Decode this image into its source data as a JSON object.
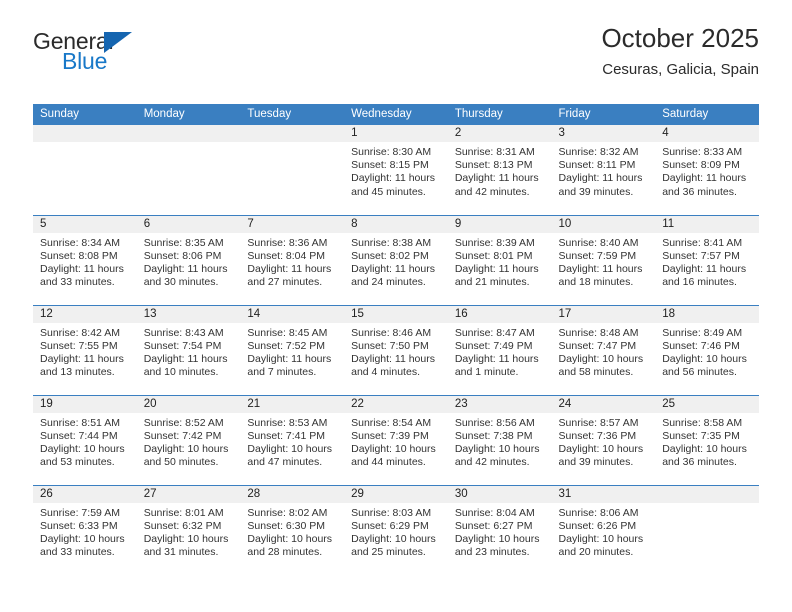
{
  "brand": {
    "name_part1": "General",
    "name_part2": "Blue",
    "accent_color": "#1878c8",
    "triangle_color": "#1565b0"
  },
  "header": {
    "title": "October 2025",
    "subtitle": "Cesuras, Galicia, Spain"
  },
  "calendar": {
    "header_bg": "#3a7fc1",
    "daynum_bg": "#f0f0f0",
    "weekday_headers": [
      "Sunday",
      "Monday",
      "Tuesday",
      "Wednesday",
      "Thursday",
      "Friday",
      "Saturday"
    ],
    "weeks": [
      [
        {
          "day": "",
          "sunrise": "",
          "sunset": "",
          "daylight_line1": "",
          "daylight_line2": ""
        },
        {
          "day": "",
          "sunrise": "",
          "sunset": "",
          "daylight_line1": "",
          "daylight_line2": ""
        },
        {
          "day": "",
          "sunrise": "",
          "sunset": "",
          "daylight_line1": "",
          "daylight_line2": ""
        },
        {
          "day": "1",
          "sunrise": "Sunrise: 8:30 AM",
          "sunset": "Sunset: 8:15 PM",
          "daylight_line1": "Daylight: 11 hours",
          "daylight_line2": "and 45 minutes."
        },
        {
          "day": "2",
          "sunrise": "Sunrise: 8:31 AM",
          "sunset": "Sunset: 8:13 PM",
          "daylight_line1": "Daylight: 11 hours",
          "daylight_line2": "and 42 minutes."
        },
        {
          "day": "3",
          "sunrise": "Sunrise: 8:32 AM",
          "sunset": "Sunset: 8:11 PM",
          "daylight_line1": "Daylight: 11 hours",
          "daylight_line2": "and 39 minutes."
        },
        {
          "day": "4",
          "sunrise": "Sunrise: 8:33 AM",
          "sunset": "Sunset: 8:09 PM",
          "daylight_line1": "Daylight: 11 hours",
          "daylight_line2": "and 36 minutes."
        }
      ],
      [
        {
          "day": "5",
          "sunrise": "Sunrise: 8:34 AM",
          "sunset": "Sunset: 8:08 PM",
          "daylight_line1": "Daylight: 11 hours",
          "daylight_line2": "and 33 minutes."
        },
        {
          "day": "6",
          "sunrise": "Sunrise: 8:35 AM",
          "sunset": "Sunset: 8:06 PM",
          "daylight_line1": "Daylight: 11 hours",
          "daylight_line2": "and 30 minutes."
        },
        {
          "day": "7",
          "sunrise": "Sunrise: 8:36 AM",
          "sunset": "Sunset: 8:04 PM",
          "daylight_line1": "Daylight: 11 hours",
          "daylight_line2": "and 27 minutes."
        },
        {
          "day": "8",
          "sunrise": "Sunrise: 8:38 AM",
          "sunset": "Sunset: 8:02 PM",
          "daylight_line1": "Daylight: 11 hours",
          "daylight_line2": "and 24 minutes."
        },
        {
          "day": "9",
          "sunrise": "Sunrise: 8:39 AM",
          "sunset": "Sunset: 8:01 PM",
          "daylight_line1": "Daylight: 11 hours",
          "daylight_line2": "and 21 minutes."
        },
        {
          "day": "10",
          "sunrise": "Sunrise: 8:40 AM",
          "sunset": "Sunset: 7:59 PM",
          "daylight_line1": "Daylight: 11 hours",
          "daylight_line2": "and 18 minutes."
        },
        {
          "day": "11",
          "sunrise": "Sunrise: 8:41 AM",
          "sunset": "Sunset: 7:57 PM",
          "daylight_line1": "Daylight: 11 hours",
          "daylight_line2": "and 16 minutes."
        }
      ],
      [
        {
          "day": "12",
          "sunrise": "Sunrise: 8:42 AM",
          "sunset": "Sunset: 7:55 PM",
          "daylight_line1": "Daylight: 11 hours",
          "daylight_line2": "and 13 minutes."
        },
        {
          "day": "13",
          "sunrise": "Sunrise: 8:43 AM",
          "sunset": "Sunset: 7:54 PM",
          "daylight_line1": "Daylight: 11 hours",
          "daylight_line2": "and 10 minutes."
        },
        {
          "day": "14",
          "sunrise": "Sunrise: 8:45 AM",
          "sunset": "Sunset: 7:52 PM",
          "daylight_line1": "Daylight: 11 hours",
          "daylight_line2": "and 7 minutes."
        },
        {
          "day": "15",
          "sunrise": "Sunrise: 8:46 AM",
          "sunset": "Sunset: 7:50 PM",
          "daylight_line1": "Daylight: 11 hours",
          "daylight_line2": "and 4 minutes."
        },
        {
          "day": "16",
          "sunrise": "Sunrise: 8:47 AM",
          "sunset": "Sunset: 7:49 PM",
          "daylight_line1": "Daylight: 11 hours",
          "daylight_line2": "and 1 minute."
        },
        {
          "day": "17",
          "sunrise": "Sunrise: 8:48 AM",
          "sunset": "Sunset: 7:47 PM",
          "daylight_line1": "Daylight: 10 hours",
          "daylight_line2": "and 58 minutes."
        },
        {
          "day": "18",
          "sunrise": "Sunrise: 8:49 AM",
          "sunset": "Sunset: 7:46 PM",
          "daylight_line1": "Daylight: 10 hours",
          "daylight_line2": "and 56 minutes."
        }
      ],
      [
        {
          "day": "19",
          "sunrise": "Sunrise: 8:51 AM",
          "sunset": "Sunset: 7:44 PM",
          "daylight_line1": "Daylight: 10 hours",
          "daylight_line2": "and 53 minutes."
        },
        {
          "day": "20",
          "sunrise": "Sunrise: 8:52 AM",
          "sunset": "Sunset: 7:42 PM",
          "daylight_line1": "Daylight: 10 hours",
          "daylight_line2": "and 50 minutes."
        },
        {
          "day": "21",
          "sunrise": "Sunrise: 8:53 AM",
          "sunset": "Sunset: 7:41 PM",
          "daylight_line1": "Daylight: 10 hours",
          "daylight_line2": "and 47 minutes."
        },
        {
          "day": "22",
          "sunrise": "Sunrise: 8:54 AM",
          "sunset": "Sunset: 7:39 PM",
          "daylight_line1": "Daylight: 10 hours",
          "daylight_line2": "and 44 minutes."
        },
        {
          "day": "23",
          "sunrise": "Sunrise: 8:56 AM",
          "sunset": "Sunset: 7:38 PM",
          "daylight_line1": "Daylight: 10 hours",
          "daylight_line2": "and 42 minutes."
        },
        {
          "day": "24",
          "sunrise": "Sunrise: 8:57 AM",
          "sunset": "Sunset: 7:36 PM",
          "daylight_line1": "Daylight: 10 hours",
          "daylight_line2": "and 39 minutes."
        },
        {
          "day": "25",
          "sunrise": "Sunrise: 8:58 AM",
          "sunset": "Sunset: 7:35 PM",
          "daylight_line1": "Daylight: 10 hours",
          "daylight_line2": "and 36 minutes."
        }
      ],
      [
        {
          "day": "26",
          "sunrise": "Sunrise: 7:59 AM",
          "sunset": "Sunset: 6:33 PM",
          "daylight_line1": "Daylight: 10 hours",
          "daylight_line2": "and 33 minutes."
        },
        {
          "day": "27",
          "sunrise": "Sunrise: 8:01 AM",
          "sunset": "Sunset: 6:32 PM",
          "daylight_line1": "Daylight: 10 hours",
          "daylight_line2": "and 31 minutes."
        },
        {
          "day": "28",
          "sunrise": "Sunrise: 8:02 AM",
          "sunset": "Sunset: 6:30 PM",
          "daylight_line1": "Daylight: 10 hours",
          "daylight_line2": "and 28 minutes."
        },
        {
          "day": "29",
          "sunrise": "Sunrise: 8:03 AM",
          "sunset": "Sunset: 6:29 PM",
          "daylight_line1": "Daylight: 10 hours",
          "daylight_line2": "and 25 minutes."
        },
        {
          "day": "30",
          "sunrise": "Sunrise: 8:04 AM",
          "sunset": "Sunset: 6:27 PM",
          "daylight_line1": "Daylight: 10 hours",
          "daylight_line2": "and 23 minutes."
        },
        {
          "day": "31",
          "sunrise": "Sunrise: 8:06 AM",
          "sunset": "Sunset: 6:26 PM",
          "daylight_line1": "Daylight: 10 hours",
          "daylight_line2": "and 20 minutes."
        },
        {
          "day": "",
          "sunrise": "",
          "sunset": "",
          "daylight_line1": "",
          "daylight_line2": ""
        }
      ]
    ]
  }
}
